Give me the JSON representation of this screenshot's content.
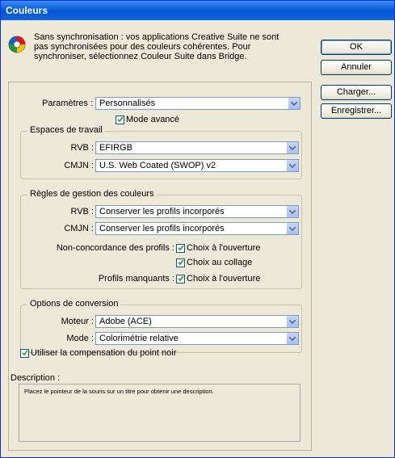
{
  "window": {
    "title": "Couleurs"
  },
  "message": "Sans synchronisation : vos applications Creative Suite ne sont pas synchronisées pour des couleurs cohérentes. Pour synchroniser, sélectionnez Couleur Suite dans Bridge.",
  "buttons": {
    "ok": "OK",
    "cancel": "Annuler",
    "load": "Charger...",
    "save": "Enregistrer..."
  },
  "settings": {
    "label": "Paramètres :",
    "value": "Personnalisés",
    "advanced_mode": "Mode avancé",
    "advanced_mode_checked": true
  },
  "working_spaces": {
    "title": "Espaces de travail",
    "rgb_label": "RVB :",
    "rgb_value": "EFIRGB",
    "cmyk_label": "CMJN :",
    "cmyk_value": "U.S. Web Coated (SWOP) v2"
  },
  "policies": {
    "title": "Règles de gestion des couleurs",
    "rgb_label": "RVB :",
    "rgb_value": "Conserver les profils incorporés",
    "cmyk_label": "CMJN :",
    "cmyk_value": "Conserver les profils incorporés",
    "mismatch_label": "Non-concordance des profils :",
    "ask_open": "Choix à l'ouverture",
    "ask_open_checked": true,
    "ask_paste": "Choix au collage",
    "ask_paste_checked": true,
    "missing_label": "Profils manquants :",
    "missing_ask_open": "Choix à l'ouverture",
    "missing_ask_open_checked": true
  },
  "conversion": {
    "title": "Options de conversion",
    "engine_label": "Moteur :",
    "engine_value": "Adobe (ACE)",
    "intent_label": "Mode :",
    "intent_value": "Colorimétrie relative",
    "bpc": "Utiliser la compensation du point noir",
    "bpc_checked": true
  },
  "description": {
    "label": "Description :",
    "text": "Placez le pointeur de la souris sur un titre pour obtenir une description."
  }
}
